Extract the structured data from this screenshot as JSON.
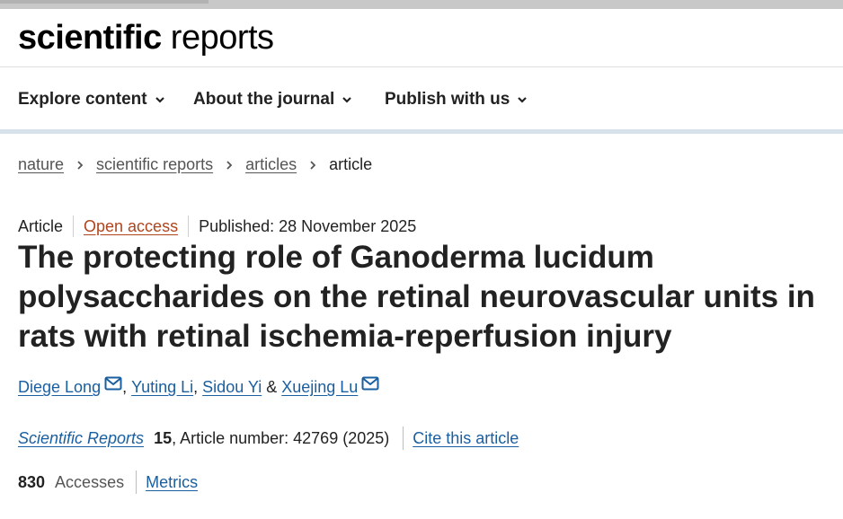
{
  "header": {
    "logo_bold": "scientific",
    "logo_light": " reports"
  },
  "nav": {
    "items": [
      {
        "label": "Explore content"
      },
      {
        "label": "About the journal"
      },
      {
        "label": "Publish with us"
      }
    ]
  },
  "breadcrumb": {
    "items": [
      {
        "label": "nature"
      },
      {
        "label": "scientific reports"
      },
      {
        "label": "articles"
      }
    ],
    "current": "article"
  },
  "article": {
    "type": "Article",
    "access": "Open access",
    "published": "Published: 28 November 2025",
    "title": "The protecting role of Ganoderma lucidum polysaccharides on the retinal neurovascular units in rats with retinal ischemia-reperfusion injury",
    "authors": {
      "a1": "Diege Long",
      "sep1": ", ",
      "a2": "Yuting Li",
      "sep2": ", ",
      "a3": "Sidou Yi",
      "sep3": " & ",
      "a4": "Xuejing Lu"
    },
    "citation": {
      "journal": "Scientific Reports",
      "volume": "15",
      "rest": ", Article number: 42769 (2025)",
      "cite_link": "Cite this article"
    },
    "metrics": {
      "accesses_count": "830",
      "accesses_label": "Accesses",
      "metrics_link": "Metrics"
    }
  },
  "icons": {
    "nav_chevron": "chevron-down-icon",
    "breadcrumb_chevron": "chevron-right-icon",
    "author_contact": "mail-icon"
  },
  "colors": {
    "link": "#1a5fa0",
    "open_access": "#b0441c",
    "nav_separator": "#d6e1ea"
  }
}
